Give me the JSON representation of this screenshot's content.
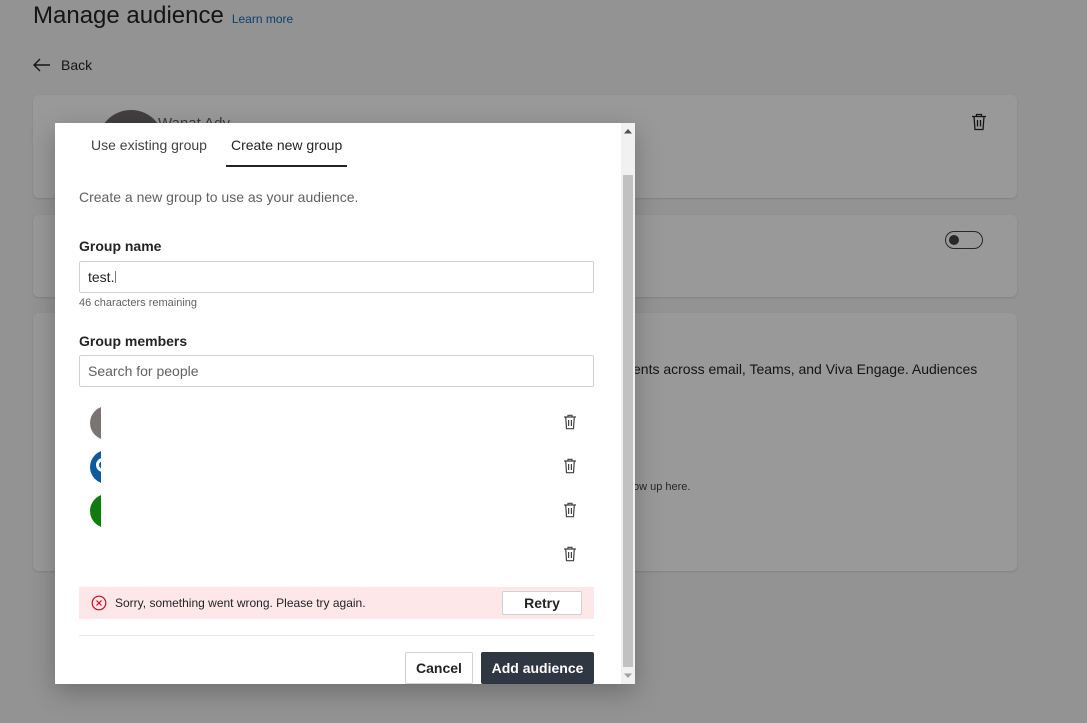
{
  "page": {
    "title": "Manage audience",
    "learn_more": "Learn more",
    "back": "Back",
    "owner_name": "Wanat Ady",
    "card3_text": "ents across email, Teams, and Viva Engage. Audiences",
    "card3_small": "ow up here."
  },
  "dialog": {
    "tabs": [
      {
        "label": "Use existing group",
        "active": false
      },
      {
        "label": "Create new group",
        "active": true
      }
    ],
    "description": "Create a new group to use as your audience.",
    "group_name_label": "Group name",
    "group_name_value": "test.",
    "chars_remaining": "46 characters remaining",
    "members_label": "Group members",
    "search_placeholder": "Search for people",
    "members": [
      {
        "avatar_color": "#7a7574"
      },
      {
        "avatar_color": "#0f5a9c"
      },
      {
        "avatar_color": "#107c10"
      },
      {
        "avatar_color": null
      }
    ],
    "error_text": "Sorry, something went wrong. Please try again.",
    "retry_label": "Retry",
    "cancel_label": "Cancel",
    "add_label": "Add audience"
  },
  "colors": {
    "primary_button": "#2f3842",
    "error_background": "#fde7e9",
    "error_icon": "#c50f1f",
    "link": "#0f6cbd"
  }
}
